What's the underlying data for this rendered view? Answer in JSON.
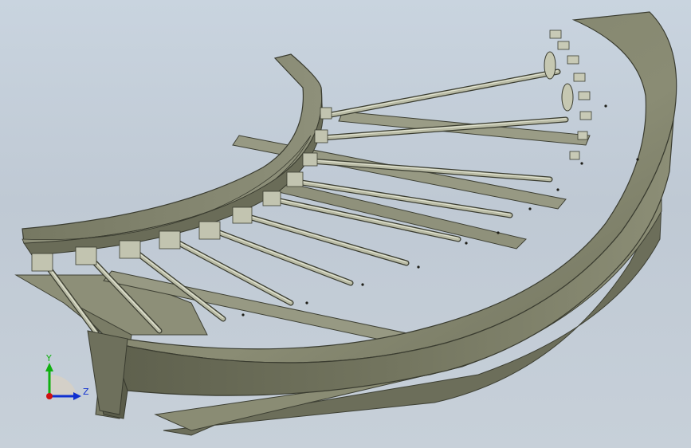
{
  "viewport": {
    "background_top": "#c9d4df",
    "background_bottom": "#c7d0d9",
    "model_body_color": "#8a8c74",
    "model_shadow_color": "#5c5e4c",
    "model_highlight_color": "#b0b29a"
  },
  "triad": {
    "y_label": "Y",
    "z_label": "Z",
    "x_color": "#d01010",
    "y_color": "#10b010",
    "z_color": "#1030d0",
    "icon": "coordinate-triad-icon"
  },
  "model": {
    "part": "curved-roller-conveyor",
    "roller_count": 11
  }
}
